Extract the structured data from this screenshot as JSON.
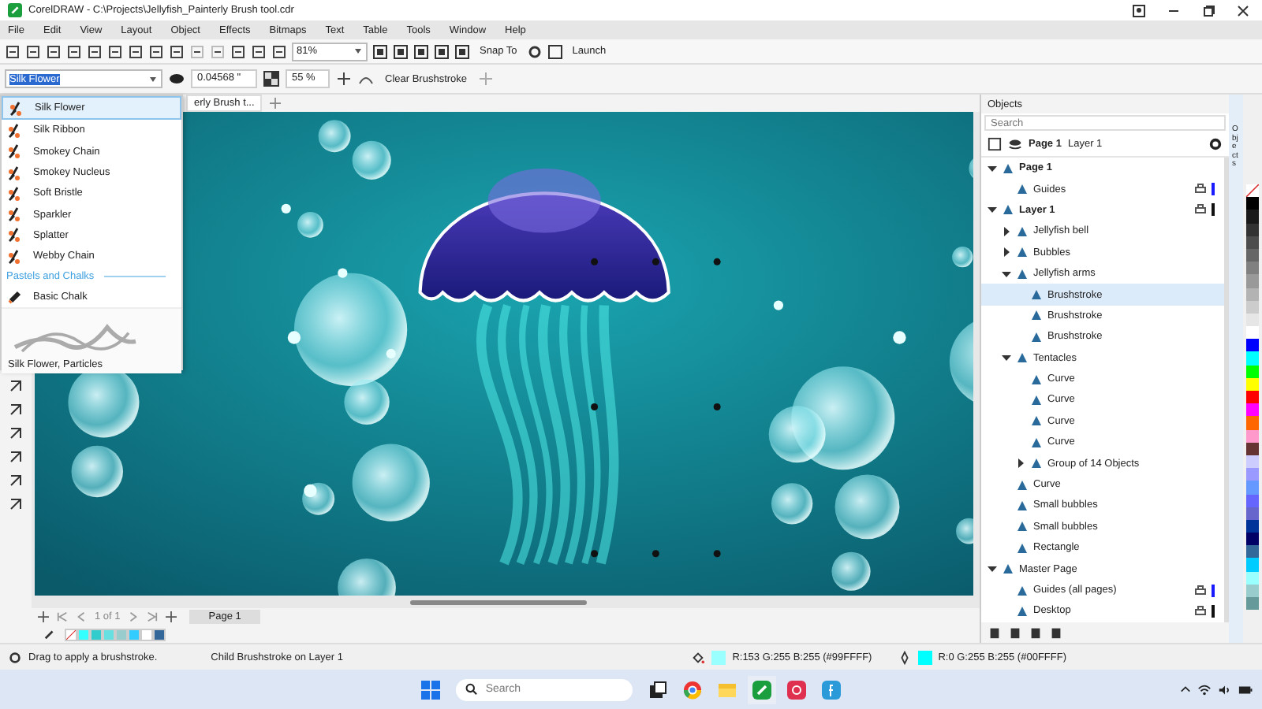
{
  "title_bar": {
    "title": "CorelDRAW - C:\\Projects\\Jellyfish_Painterly Brush tool.cdr"
  },
  "menu": [
    "File",
    "Edit",
    "View",
    "Layout",
    "Object",
    "Effects",
    "Bitmaps",
    "Text",
    "Table",
    "Tools",
    "Window",
    "Help"
  ],
  "toolbar": {
    "zoom": "81%",
    "snap": "Snap To",
    "launch": "Launch"
  },
  "property_bar": {
    "brush": "Silk Flower",
    "size": "0.04568 \"",
    "opacity": "55 %",
    "clear": "Clear Brushstroke"
  },
  "brush_list": {
    "items": [
      {
        "label": "Silk Flower",
        "selected": true
      },
      {
        "label": "Silk Ribbon",
        "selected": false
      },
      {
        "label": "Smokey Chain",
        "selected": false
      },
      {
        "label": "Smokey Nucleus",
        "selected": false
      },
      {
        "label": "Soft Bristle",
        "selected": false
      },
      {
        "label": "Sparkler",
        "selected": false
      },
      {
        "label": "Splatter",
        "selected": false
      },
      {
        "label": "Webby Chain",
        "selected": false
      }
    ],
    "category": "Pastels and Chalks",
    "category_items": [
      {
        "label": "Basic Chalk",
        "selected": false
      }
    ],
    "preview_caption": "Silk Flower, Particles"
  },
  "document_tab": "erly Brush t...",
  "objects_panel": {
    "title": "Objects",
    "search_placeholder": "Search",
    "page": "Page 1",
    "layer": "Layer 1",
    "side_tab": "Objects",
    "tree": [
      {
        "label": "Page 1",
        "bold": true,
        "selected": false,
        "expanded": true,
        "children": [
          {
            "label": "Guides",
            "selected": false,
            "color": "#1a1aff"
          }
        ]
      },
      {
        "label": "Layer 1",
        "bold": true,
        "selected": false,
        "expanded": true,
        "color": "#111111",
        "children": [
          {
            "label": "Jellyfish bell",
            "selected": false,
            "expanded": false
          },
          {
            "label": "Bubbles",
            "selected": false,
            "expanded": false
          },
          {
            "label": "Jellyfish arms",
            "selected": false,
            "expanded": true,
            "children": [
              {
                "label": "Brushstroke",
                "selected": true
              },
              {
                "label": "Brushstroke",
                "selected": false
              },
              {
                "label": "Brushstroke",
                "selected": false
              }
            ]
          },
          {
            "label": "Tentacles",
            "selected": false,
            "expanded": true,
            "children": [
              {
                "label": "Curve",
                "selected": false
              },
              {
                "label": "Curve",
                "selected": false
              },
              {
                "label": "Curve",
                "selected": false
              },
              {
                "label": "Curve",
                "selected": false
              },
              {
                "label": "Group of 14 Objects",
                "selected": false,
                "expanded": false
              }
            ]
          },
          {
            "label": "Curve",
            "selected": false
          },
          {
            "label": "Small bubbles",
            "selected": false
          },
          {
            "label": "Small bubbles",
            "selected": false
          },
          {
            "label": "Rectangle",
            "selected": false
          }
        ]
      },
      {
        "label": "Master Page",
        "bold": false,
        "selected": false,
        "expanded": true,
        "children": [
          {
            "label": "Guides (all pages)",
            "selected": false,
            "color": "#1a1aff"
          },
          {
            "label": "Desktop",
            "selected": false,
            "color": "#111111"
          }
        ]
      }
    ]
  },
  "page_nav": {
    "count": "1 of 1",
    "tab": "Page 1"
  },
  "document_palette": [
    {
      "color": "#33ffff"
    },
    {
      "color": "#33cccc"
    },
    {
      "color": "#66e0e0"
    },
    {
      "color": "#99cccc"
    },
    {
      "color": "#33ccff"
    },
    {
      "color": "#ffffff"
    },
    {
      "color": "#336699"
    }
  ],
  "palette": [
    {
      "color": "#000000"
    },
    {
      "color": "#1a1a1a"
    },
    {
      "color": "#333333"
    },
    {
      "color": "#4d4d4d"
    },
    {
      "color": "#666666"
    },
    {
      "color": "#808080"
    },
    {
      "color": "#999999"
    },
    {
      "color": "#b3b3b3"
    },
    {
      "color": "#cccccc"
    },
    {
      "color": "#e6e6e6"
    },
    {
      "color": "#ffffff"
    },
    {
      "color": "#0000ff"
    },
    {
      "color": "#00ffff"
    },
    {
      "color": "#00ff00"
    },
    {
      "color": "#ffff00"
    },
    {
      "color": "#ff0000"
    },
    {
      "color": "#ff00ff"
    },
    {
      "color": "#ff6600"
    },
    {
      "color": "#ff99cc"
    },
    {
      "color": "#663333"
    },
    {
      "color": "#ccccff"
    },
    {
      "color": "#9999ff"
    },
    {
      "color": "#6699ff"
    },
    {
      "color": "#6666ff"
    },
    {
      "color": "#6666cc"
    },
    {
      "color": "#003399"
    },
    {
      "color": "#000066"
    },
    {
      "color": "#336699"
    },
    {
      "color": "#00ccff"
    },
    {
      "color": "#99ffff"
    },
    {
      "color": "#99cccc"
    },
    {
      "color": "#669999"
    }
  ],
  "status_bar": {
    "hint": "Drag to apply a brushstroke.",
    "selection": "Child Brushstroke on Layer 1",
    "fill": "R:153 G:255 B:255 (#99FFFF)",
    "outline": "R:0 G:255 B:255 (#00FFFF)"
  },
  "taskbar": {
    "search_placeholder": "Search"
  }
}
